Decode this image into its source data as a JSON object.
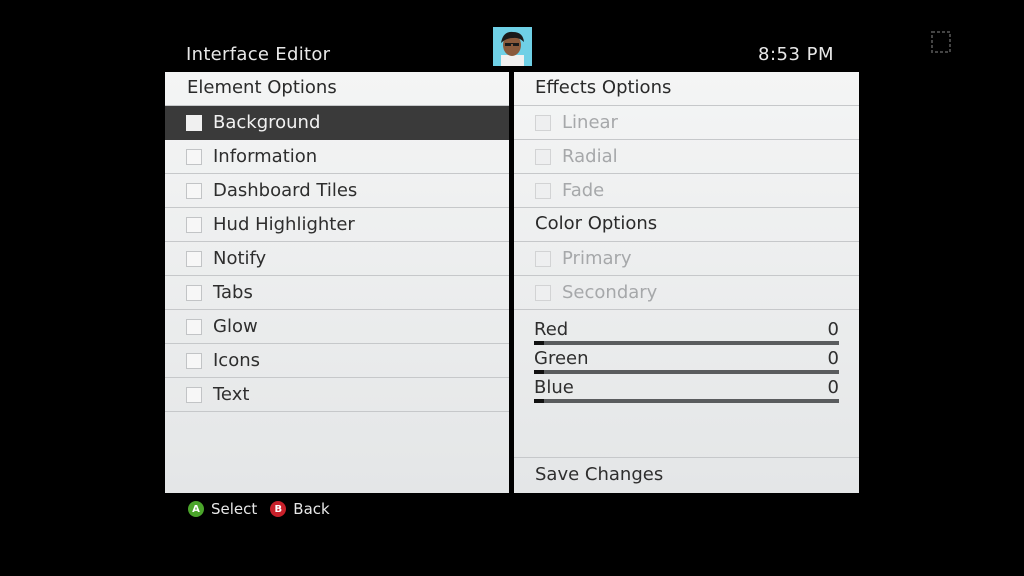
{
  "header": {
    "title": "Interface Editor",
    "clock": "8:53  PM"
  },
  "left_panel": {
    "title": "Element Options",
    "items": [
      {
        "label": "Background",
        "selected": true
      },
      {
        "label": "Information"
      },
      {
        "label": "Dashboard Tiles"
      },
      {
        "label": "Hud Highlighter"
      },
      {
        "label": "Notify"
      },
      {
        "label": "Tabs"
      },
      {
        "label": "Glow"
      },
      {
        "label": "Icons"
      },
      {
        "label": "Text"
      }
    ]
  },
  "right_panel": {
    "effects_title": "Effects Options",
    "effects": [
      {
        "label": "Linear"
      },
      {
        "label": "Radial"
      },
      {
        "label": "Fade"
      }
    ],
    "color_title": "Color Options",
    "colors": [
      {
        "label": "Primary"
      },
      {
        "label": "Secondary"
      }
    ],
    "sliders": [
      {
        "label": "Red",
        "value": "0",
        "fraction": 0.0
      },
      {
        "label": "Green",
        "value": "0",
        "fraction": 0.0
      },
      {
        "label": "Blue",
        "value": "0",
        "fraction": 0.0
      }
    ],
    "save_label": "Save Changes"
  },
  "footer": {
    "a_glyph": "A",
    "a_label": "Select",
    "b_glyph": "B",
    "b_label": "Back"
  },
  "colors": {
    "a_button": "#4ba52b",
    "b_button": "#c8202a",
    "selected_row": "#3a3a3a",
    "avatar_background": "#6fd0e6"
  }
}
